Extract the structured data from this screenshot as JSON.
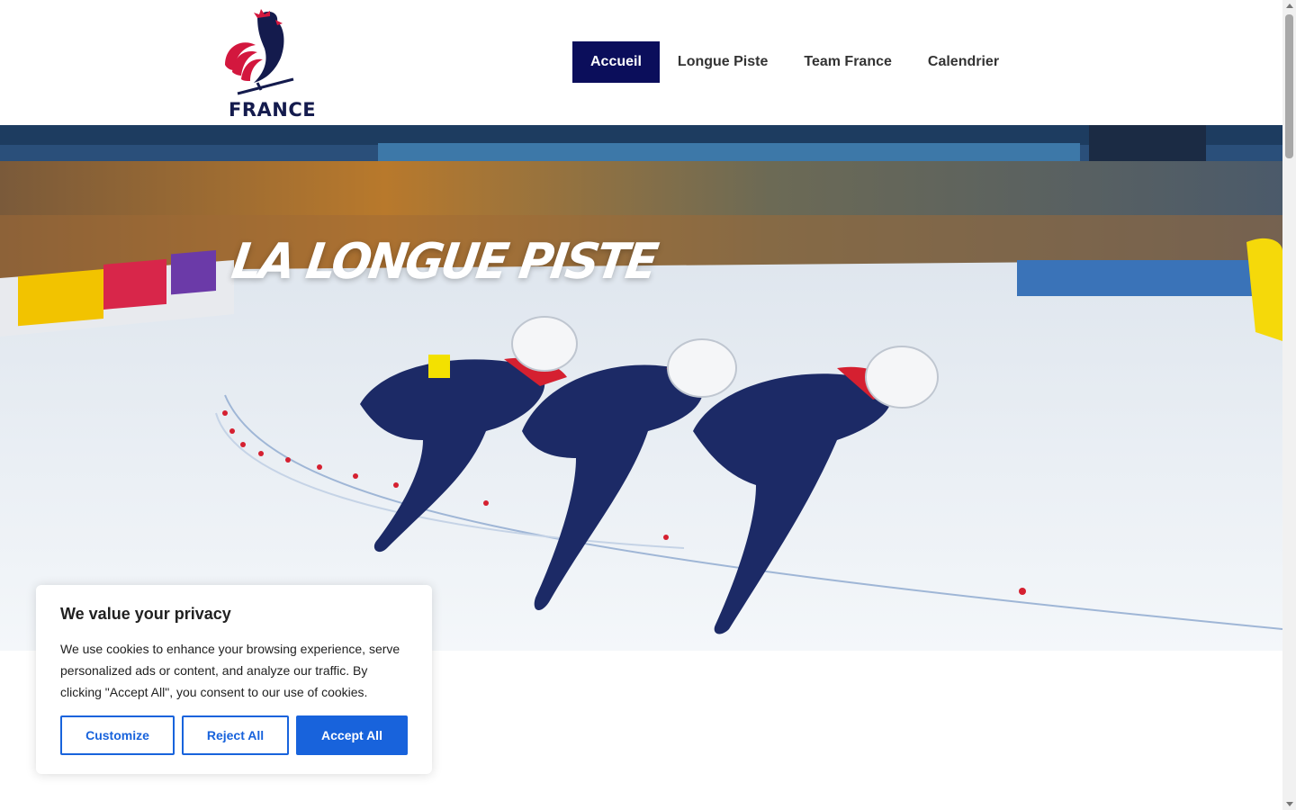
{
  "header": {
    "logo_text": "FRANCE",
    "nav": [
      {
        "label": "Accueil",
        "active": true
      },
      {
        "label": "Longue Piste",
        "active": false
      },
      {
        "label": "Team France",
        "active": false
      },
      {
        "label": "Calendrier",
        "active": false
      }
    ]
  },
  "hero": {
    "title": "LA LONGUE PISTE"
  },
  "cookie_banner": {
    "title": "We value your privacy",
    "text": "We use cookies to enhance your browsing experience, serve personalized ads or content, and analyze our traffic. By clicking \"Accept All\", you consent to our use of cookies.",
    "customize_label": "Customize",
    "reject_label": "Reject All",
    "accept_label": "Accept All"
  },
  "colors": {
    "nav_active_bg": "#0b0e5b",
    "brand_navy": "#141b4d",
    "brand_red": "#d3173e",
    "button_blue": "#1863dc"
  },
  "icons": [
    "rooster-logo-icon",
    "scroll-up-icon",
    "scroll-down-icon"
  ]
}
